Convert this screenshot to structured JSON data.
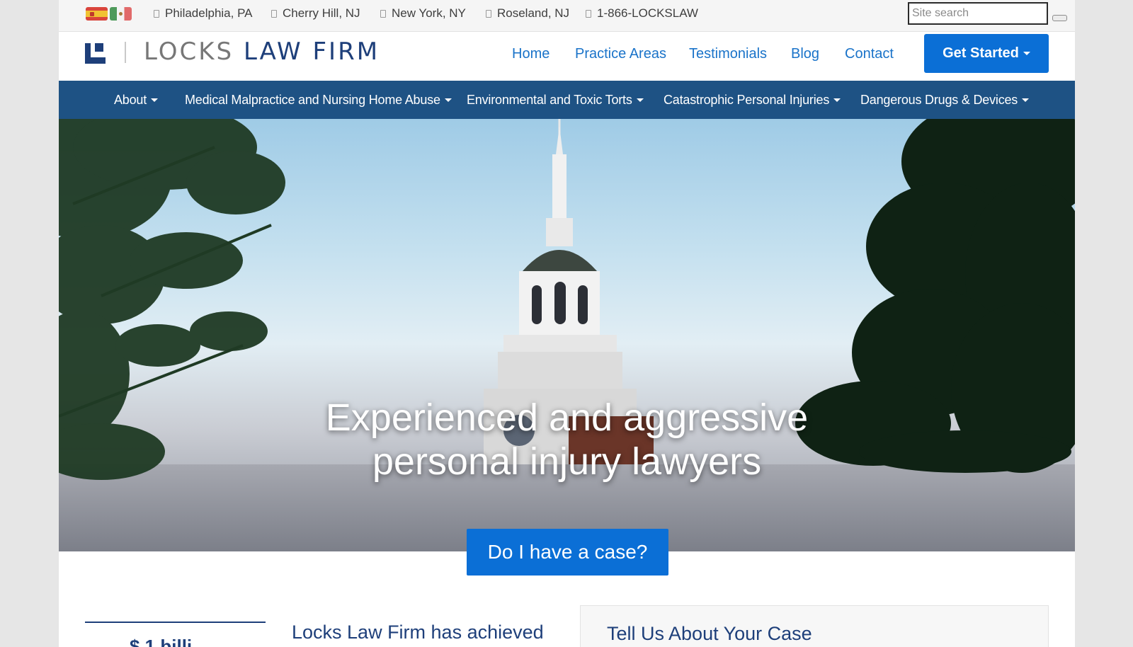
{
  "topbar": {
    "languages": [
      {
        "icon": "spain-flag-icon"
      },
      {
        "icon": "mexico-flag-icon"
      }
    ],
    "locations": [
      {
        "label": "Philadelphia, PA",
        "icon": "location-icon"
      },
      {
        "label": "Cherry Hill, NJ",
        "icon": "location-icon"
      },
      {
        "label": "New York, NY",
        "icon": "location-icon"
      },
      {
        "label": "Roseland, NJ",
        "icon": "location-icon"
      },
      {
        "label": "1-866-LOCKSLAW",
        "icon": "phone-icon"
      }
    ],
    "search": {
      "placeholder": "Site search",
      "value": ""
    }
  },
  "header": {
    "logo": {
      "word1": "LOCKS",
      "word2": "LAW FIRM"
    },
    "nav": [
      {
        "label": "Home"
      },
      {
        "label": "Practice Areas"
      },
      {
        "label": "Testimonials"
      },
      {
        "label": "Blog"
      },
      {
        "label": "Contact"
      }
    ],
    "cta_label": "Get Started"
  },
  "mainnav": {
    "items": [
      {
        "label": "About"
      },
      {
        "label": "Medical Malpractice and Nursing Home Abuse"
      },
      {
        "label": "Environmental and Toxic Torts"
      },
      {
        "label": "Catastrophic Personal Injuries"
      },
      {
        "label": "Dangerous Drugs & Devices"
      }
    ]
  },
  "hero": {
    "title_line1": "Experienced and aggressive",
    "title_line2": "personal injury lawyers",
    "cta_label": "Do I have a case?"
  },
  "content": {
    "stat_value": "$ 1 billi",
    "intro": "Locks Law Firm has achieved",
    "case_form_title": "Tell Us About Your Case"
  },
  "colors": {
    "brand_navy": "#1e3f7a",
    "nav_bar": "#1e5284",
    "primary_button": "#0b6fd6",
    "link": "#1a73c9"
  }
}
